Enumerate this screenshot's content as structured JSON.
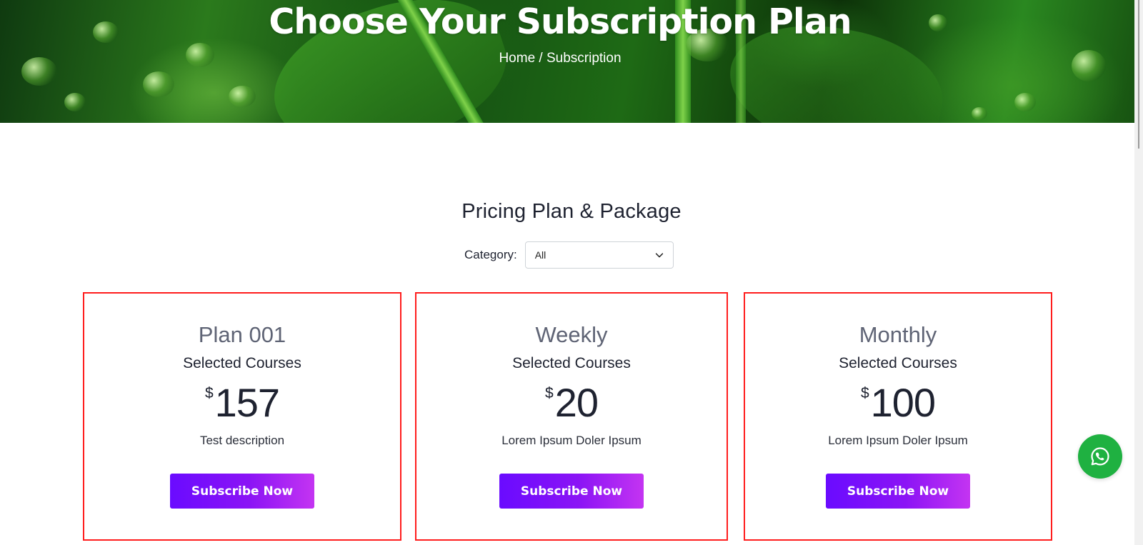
{
  "hero": {
    "title": "Choose Your Subscription Plan",
    "breadcrumb": "Home / Subscription"
  },
  "section": {
    "title": "Pricing Plan & Package",
    "category_label": "Category:",
    "category_value": "All"
  },
  "plans": [
    {
      "name": "Plan 001",
      "subtitle": "Selected Courses",
      "currency": "$",
      "price": "157",
      "description": "Test description",
      "button": "Subscribe Now"
    },
    {
      "name": "Weekly",
      "subtitle": "Selected Courses",
      "currency": "$",
      "price": "20",
      "description": "Lorem Ipsum Doler Ipsum",
      "button": "Subscribe Now"
    },
    {
      "name": "Monthly",
      "subtitle": "Selected Courses",
      "currency": "$",
      "price": "100",
      "description": "Lorem Ipsum Doler Ipsum",
      "button": "Subscribe Now"
    }
  ],
  "colors": {
    "card_border": "#ff1d1d",
    "button_gradient_start": "#6a0bff",
    "button_gradient_end": "#c434f2",
    "whatsapp": "#1fb141"
  },
  "icons": {
    "select_caret": "chevron-down-icon",
    "floating_action": "whatsapp-icon"
  }
}
